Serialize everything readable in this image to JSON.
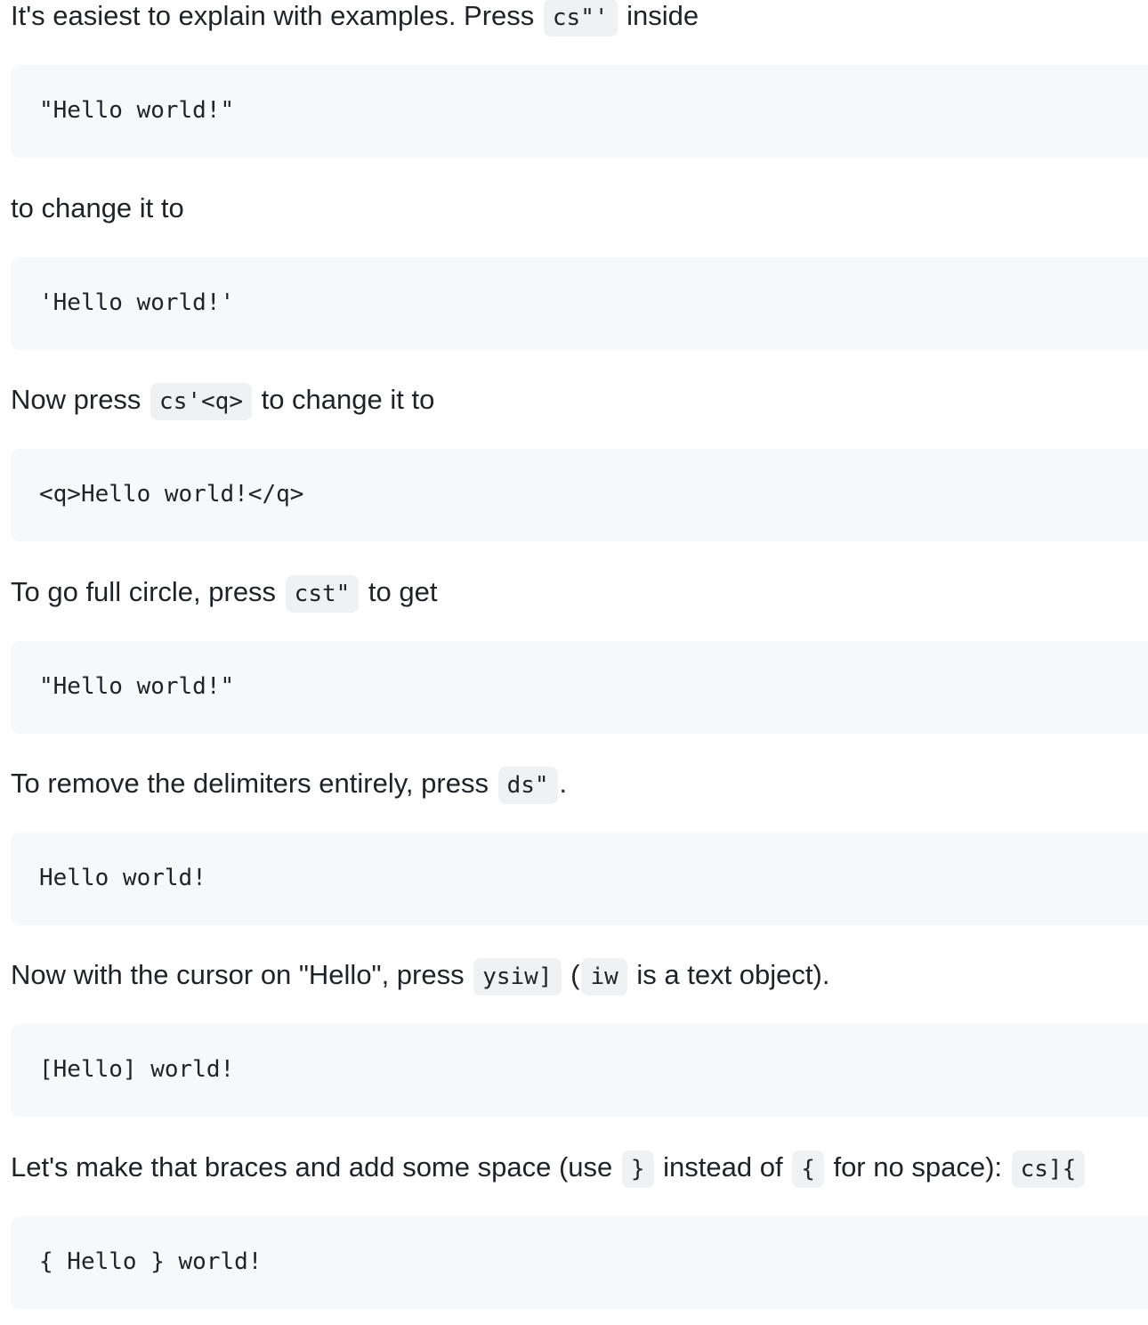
{
  "paragraphs": [
    {
      "text_1": "It's easiest to explain with examples. Press ",
      "code_1": "cs\"'",
      "text_2": " inside"
    },
    {
      "text_1": "to change it to"
    },
    {
      "text_1": "Now press ",
      "code_1": "cs'<q>",
      "text_2": " to change it to"
    },
    {
      "text_1": "To go full circle, press ",
      "code_1": "cst\"",
      "text_2": " to get"
    },
    {
      "text_1": "To remove the delimiters entirely, press ",
      "code_1": "ds\"",
      "text_2": "."
    },
    {
      "text_1": "Now with the cursor on \"Hello\", press ",
      "code_1": "ysiw]",
      "text_2": " (",
      "code_2": "iw",
      "text_3": " is a text object)."
    },
    {
      "text_1": "Let's make that braces and add some space (use ",
      "code_1": "}",
      "text_2": " instead of ",
      "code_2": "{",
      "text_3": " for no space): ",
      "code_3": "cs]{"
    }
  ],
  "code_blocks": [
    "\"Hello world!\"",
    "'Hello world!'",
    "<q>Hello world!</q>",
    "\"Hello world!\"",
    "Hello world!",
    "[Hello] world!",
    "{ Hello } world!"
  ]
}
